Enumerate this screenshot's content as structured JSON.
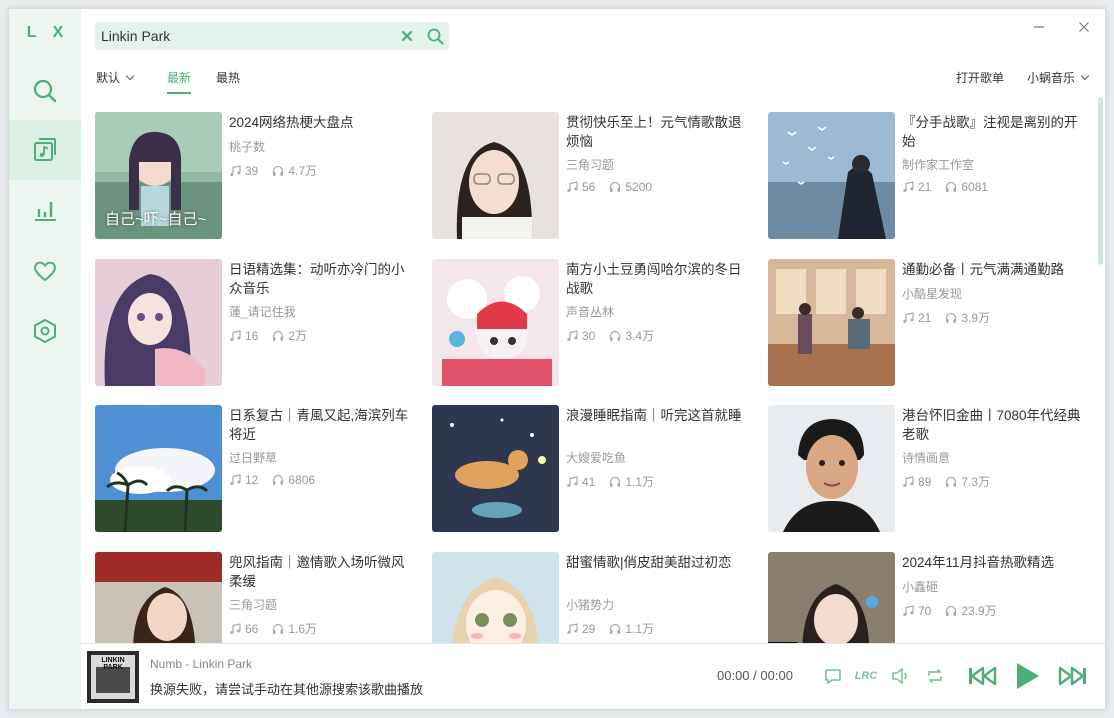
{
  "app": {
    "logo": "L X"
  },
  "sidebar": {
    "items": [
      {
        "name": "search",
        "icon": "search-icon"
      },
      {
        "name": "songlist",
        "icon": "music-list-icon",
        "active": true
      },
      {
        "name": "leaderboard",
        "icon": "bar-chart-icon"
      },
      {
        "name": "favorites",
        "icon": "heart-icon"
      },
      {
        "name": "settings",
        "icon": "hexagon-settings-icon"
      }
    ]
  },
  "search": {
    "value": "Linkin Park",
    "placeholder": ""
  },
  "filters": {
    "sort_label": "默认",
    "tabs": [
      {
        "label": "最新",
        "active": true
      },
      {
        "label": "最热",
        "active": false
      }
    ],
    "open_playlist": "打开歌单",
    "source": "小蜗音乐"
  },
  "playlists": [
    {
      "title": "2024网络热梗大盘点",
      "author": "桃子数",
      "songs": "39",
      "plays": "4.7万",
      "cover_text": "自己~吓~自己~"
    },
    {
      "title": "贯彻快乐至上！元气情歌散退烦恼",
      "author": "三角习题",
      "songs": "56",
      "plays": "5200"
    },
    {
      "title": "『分手战歌』注视是离别的开始",
      "author": "制作家工作室",
      "songs": "21",
      "plays": "6081"
    },
    {
      "title": "日语精选集：动听亦冷门的小众音乐",
      "author": "蓮_请记住我",
      "songs": "16",
      "plays": "2万"
    },
    {
      "title": "南方小土豆勇闯哈尔滨的冬日战歌",
      "author": "声音丛林",
      "songs": "30",
      "plays": "3.4万"
    },
    {
      "title": "通勤必备丨元气满满通勤路",
      "author": "小酷星发现",
      "songs": "21",
      "plays": "3.9万"
    },
    {
      "title": "日系复古｜青風又起,海滨列车将近",
      "author": "过日野草",
      "songs": "12",
      "plays": "6806"
    },
    {
      "title": "浪漫睡眠指南｜听完这首就睡",
      "author": "大嫂爱吃鱼",
      "songs": "41",
      "plays": "1.1万"
    },
    {
      "title": "港台怀旧金曲丨7080年代经典老歌",
      "author": "诗情画意",
      "songs": "89",
      "plays": "7.3万"
    },
    {
      "title": "兜风指南｜邀情歌入场听微风柔缓",
      "author": "三角习题",
      "songs": "66",
      "plays": "1.6万"
    },
    {
      "title": "甜蜜情歌|俏皮甜美甜过初恋",
      "author": "小猪势力",
      "songs": "29",
      "plays": "1.1万"
    },
    {
      "title": "2024年11月抖音热歌精选",
      "author": "小鑫砸",
      "songs": "70",
      "plays": "23.9万"
    }
  ],
  "player": {
    "album_text": "LINKIN PARK",
    "song": "Numb - Linkin Park",
    "message": "换源失败，请尝试手动在其他源搜索该歌曲播放",
    "current_time": "00:00",
    "separator": "/",
    "total_time": "00:00",
    "lrc": "LRC"
  },
  "colors": {
    "accent": "#4caf7a",
    "sidebar_bg": "#edf5f1",
    "search_bg": "#e3f2ea"
  }
}
